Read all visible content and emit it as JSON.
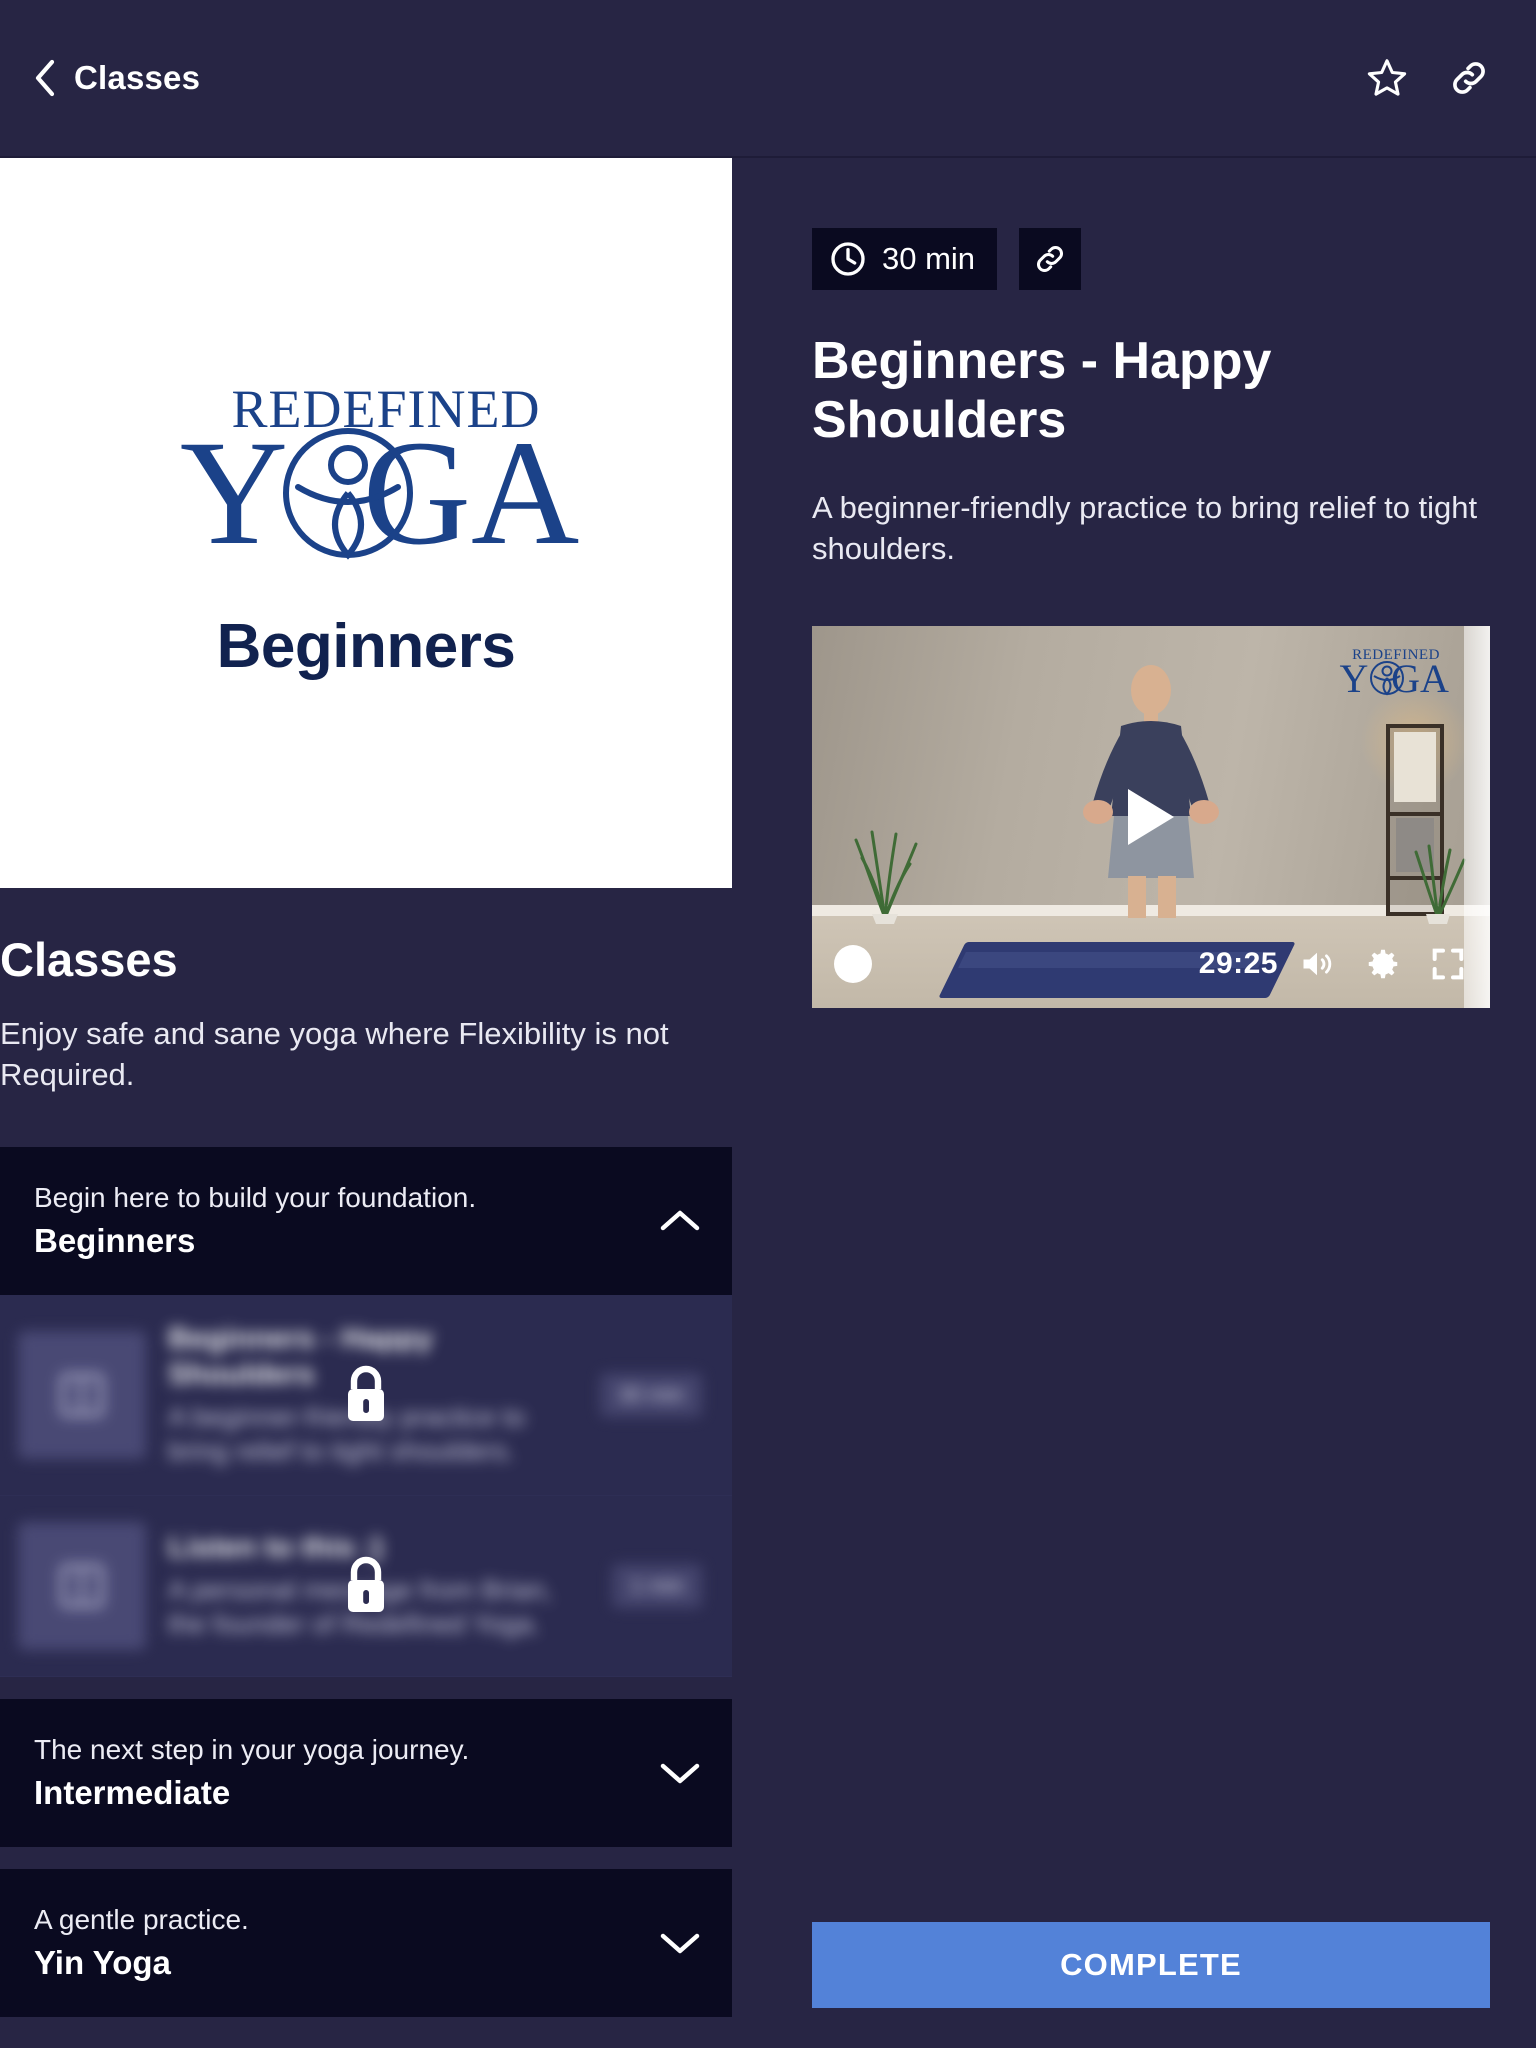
{
  "header": {
    "back_label": "Classes",
    "back_icon": "chevron-left-icon",
    "favorite_icon": "star-icon",
    "share_icon": "link-icon"
  },
  "cover": {
    "brand_line1": "REDEFINED",
    "brand_line2": "YOGA",
    "subtitle": "Beginners"
  },
  "left": {
    "section_title": "Classes",
    "section_desc": "Enjoy safe and sane yoga where Flexibility is not Required.",
    "sections": [
      {
        "kicker": "Begin here to build your foundation.",
        "title": "Beginners",
        "expanded": true,
        "chevron": "chevron-up-icon",
        "lessons": [
          {
            "title": "Beginners - Happy Shoulders",
            "desc": "A beginner-friendly practice to bring relief to tight shoulders.",
            "duration": "30 min",
            "locked": true,
            "lock_icon": "lock-icon",
            "thumb_icon": "book-icon"
          },
          {
            "title": "Listen to this :)",
            "desc": "A personal message from Brian, the founder of Redefined Yoga.",
            "duration": "1 min",
            "locked": true,
            "lock_icon": "lock-icon",
            "thumb_icon": "book-icon"
          }
        ]
      },
      {
        "kicker": "The next step in your yoga journey.",
        "title": "Intermediate",
        "expanded": false,
        "chevron": "chevron-down-icon",
        "lessons": []
      },
      {
        "kicker": "A gentle practice.",
        "title": "Yin Yoga",
        "expanded": false,
        "chevron": "chevron-down-icon",
        "lessons": []
      }
    ]
  },
  "detail": {
    "duration_badge": "30 min",
    "duration_icon": "clock-icon",
    "share_icon": "link-icon",
    "title": "Beginners - Happy Shoulders",
    "description": "A beginner-friendly practice to bring relief to tight shoulders.",
    "video": {
      "play_icon": "play-icon",
      "progress_handle": "progress-handle",
      "time_remaining": "29:25",
      "volume_icon": "volume-icon",
      "settings_icon": "gear-icon",
      "fullscreen_icon": "fullscreen-icon",
      "watermark_line1": "REDEFINED",
      "watermark_line2": "YOGA"
    },
    "complete_label": "COMPLETE"
  },
  "colors": {
    "background": "#272544",
    "panel_dark": "#0a0a20",
    "locked_row": "#2b2b50",
    "accent_button": "#5382d8",
    "brand_blue": "#1b4289",
    "text_primary": "#ffffff"
  }
}
